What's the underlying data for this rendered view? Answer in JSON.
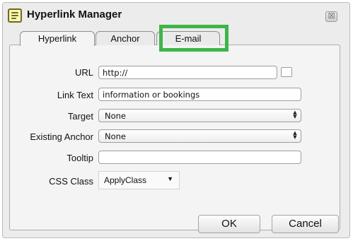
{
  "window": {
    "title": "Hyperlink Manager",
    "close_glyph": "☒"
  },
  "tabs": [
    {
      "label": "Hyperlink",
      "active": true
    },
    {
      "label": "Anchor",
      "active": false
    },
    {
      "label": "E-mail",
      "active": false
    }
  ],
  "form": {
    "url": {
      "label": "URL",
      "value": "http://"
    },
    "link_text": {
      "label": "Link Text",
      "value": "information or bookings"
    },
    "target": {
      "label": "Target",
      "value": "None"
    },
    "existing_anchor": {
      "label": "Existing Anchor",
      "value": "None"
    },
    "tooltip": {
      "label": "Tooltip",
      "value": ""
    },
    "css_class": {
      "label": "CSS Class",
      "value": "ApplyClass"
    }
  },
  "buttons": {
    "ok": "OK",
    "cancel": "Cancel"
  },
  "icons": {
    "app": "hyperlink-manager-icon",
    "stepper": "up-down-stepper-icon",
    "dropdown": "dropdown-caret-icon"
  },
  "colors": {
    "highlight": "#3fb44a"
  }
}
